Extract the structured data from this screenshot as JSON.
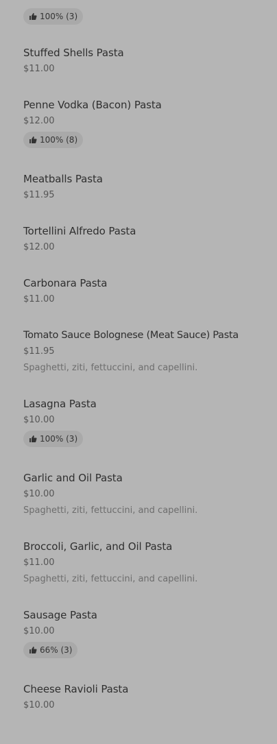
{
  "top_badge": {
    "icon": "thumbs-up-icon",
    "rating": "100% (3)"
  },
  "items": [
    {
      "name": "Stuffed Shells Pasta",
      "price": "$11.00"
    },
    {
      "name": "Penne Vodka (Bacon) Pasta",
      "price": "$12.00",
      "rating": "100% (8)"
    },
    {
      "name": "Meatballs Pasta",
      "price": "$11.95"
    },
    {
      "name": "Tortellini Alfredo Pasta",
      "price": "$12.00"
    },
    {
      "name": "Carbonara Pasta",
      "price": "$11.00"
    },
    {
      "name": "Tomato Sauce Bolognese (Meat Sauce) Pasta",
      "price": "$11.95",
      "description": "Spaghetti, ziti, fettuccini, and capellini."
    },
    {
      "name": "Lasagna Pasta",
      "price": "$10.00",
      "rating": "100% (3)"
    },
    {
      "name": "Garlic and Oil Pasta",
      "price": "$10.00",
      "description": "Spaghetti, ziti, fettuccini, and capellini."
    },
    {
      "name": "Broccoli, Garlic, and Oil Pasta",
      "price": "$11.00",
      "description": "Spaghetti, ziti, fettuccini, and capellini."
    },
    {
      "name": "Sausage Pasta",
      "price": "$10.00",
      "rating": "66% (3)"
    },
    {
      "name": "Cheese Ravioli Pasta",
      "price": "$10.00"
    }
  ],
  "colors": {
    "background": "#b5b5b5",
    "badge": "#a9a9a9",
    "text": "#2f2f2f"
  }
}
